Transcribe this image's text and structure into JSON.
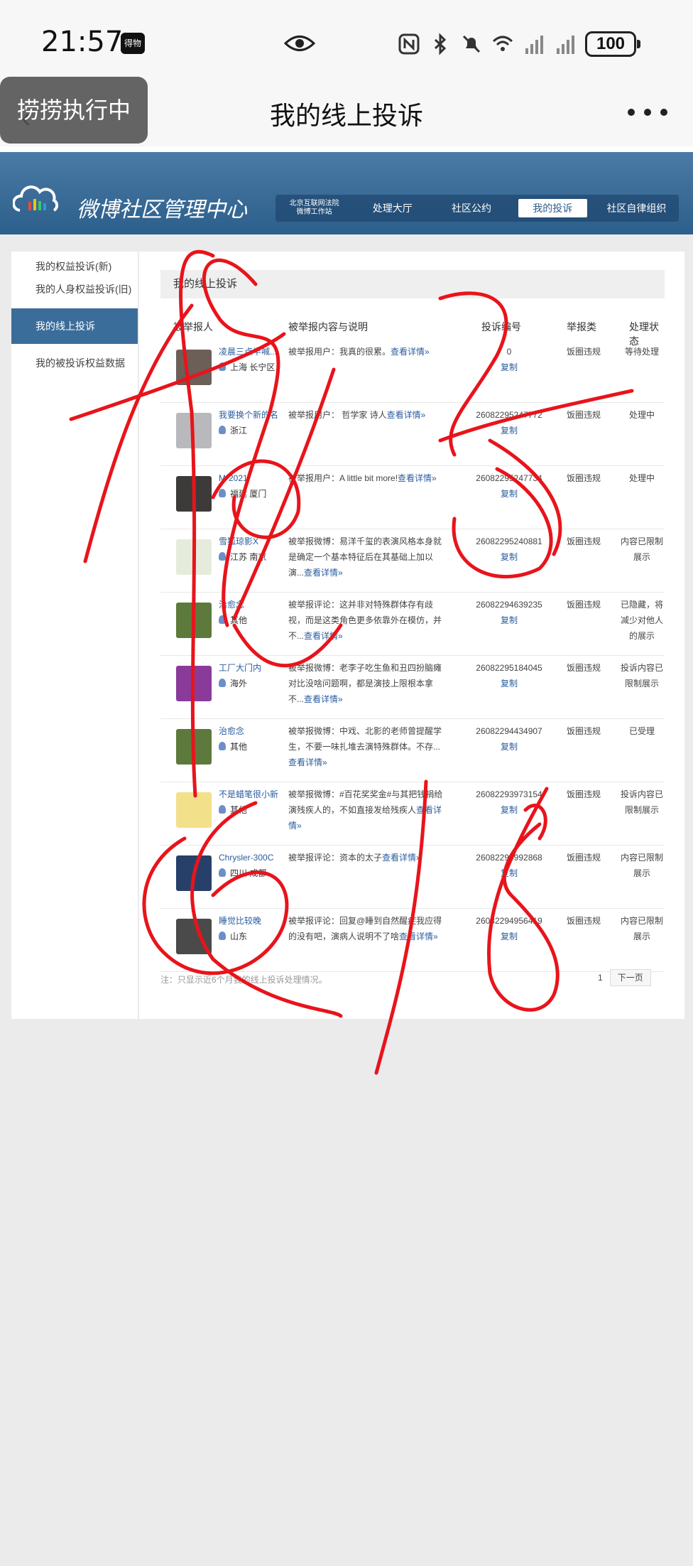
{
  "status_bar": {
    "time": "21:57",
    "badge": "得物",
    "battery": "100"
  },
  "app_header": {
    "title": "我的线上投诉",
    "toast": "捞捞执行中"
  },
  "site": {
    "logo_text": "微博社区管理中心",
    "nav": {
      "court_line1": "北京互联网法院",
      "court_line2": "微博工作站",
      "hall": "处理大厅",
      "rules": "社区公约",
      "mine": "我的投诉",
      "org": "社区自律组织"
    }
  },
  "sidebar": {
    "items": [
      {
        "label": "我的权益投诉(新)"
      },
      {
        "label": "我的人身权益投诉(旧)"
      },
      {
        "label": "我的线上投诉"
      },
      {
        "label": "我的被投诉权益数据"
      }
    ]
  },
  "main": {
    "title": "我的线上投诉",
    "columns": {
      "reporter": "被举报人",
      "content": "被举报内容与说明",
      "id": "投诉编号",
      "category": "举报类",
      "status": "处理状态"
    },
    "copy_label": "复制",
    "rows": [
      {
        "name": "凌晨三点半喊...",
        "location": "上海 长宁区",
        "content": "被举报用户：我真的很累。",
        "more": "查看详情»",
        "cid": "0",
        "category": "饭圈违规",
        "status": "等待处理",
        "avatar_color": "#6b5f58"
      },
      {
        "name": "我要换个新的名",
        "location": "浙江",
        "content": "被举报用户： 哲学家 诗人",
        "more": "查看详情»",
        "cid": "26082295247772",
        "category": "饭圈违规",
        "status": "处理中",
        "avatar_color": "#b9b9bd"
      },
      {
        "name": "M·2021",
        "location": "福建 厦门",
        "content": "被举报用户：A little bit more!",
        "more": "查看详情»",
        "cid": "26082295247734",
        "category": "饭圈违规",
        "status": "处理中",
        "avatar_color": "#3d3a3a"
      },
      {
        "name": "雪狐琼影X",
        "location": "江苏 南京",
        "content": "被举报微博：易洋千玺的表演风格本身就是确定一个基本特征后在其基础上加以演...",
        "more": "查看详情»",
        "cid": "26082295240881",
        "category": "饭圈违规",
        "status": "内容已限制展示",
        "avatar_color": "#e6ecdc"
      },
      {
        "name": "治愈念",
        "location": "其他",
        "content": "被举报评论：这并非对特殊群体存有歧视，而是这类角色更多依靠外在模仿，并不...",
        "more": "查看详情»",
        "cid": "26082294639235",
        "category": "饭圈违规",
        "status": "已隐藏，将减少对他人的展示",
        "avatar_color": "#5d7a3c"
      },
      {
        "name": "工厂大门内",
        "location": "海外",
        "content": "被举报微博：老李子吃生鱼和丑四扮脑瘫对比没啥问题啊，都是演技上限根本拿不...",
        "more": "查看详情»",
        "cid": "26082295184045",
        "category": "饭圈违规",
        "status": "投诉内容已限制展示",
        "avatar_color": "#8a3b9a"
      },
      {
        "name": "治愈念",
        "location": "其他",
        "content": "被举报微博：中戏、北影的老师曾提醒学生，不要一味扎堆去演特殊群体。不存...",
        "more": "查看详情»",
        "cid": "26082294434907",
        "category": "饭圈违规",
        "status": "已受理",
        "avatar_color": "#5d7a3c"
      },
      {
        "name": "不是蜡笔很小新",
        "location": "其他",
        "content": "被举报微博：#百花奖奖金#与其把钱捐给演残疾人的，不如直接发给残疾人",
        "more": "查看详情»",
        "cid": "26082293973154",
        "category": "饭圈违规",
        "status": "投诉内容已限制展示",
        "avatar_color": "#f2e08a"
      },
      {
        "name": "Chrysler-300C",
        "location": "四川 成都",
        "content": "被举报评论：资本的太子",
        "more": "查看详情»",
        "cid": "26082294992868",
        "category": "饭圈违规",
        "status": "内容已限制展示",
        "avatar_color": "#27406a"
      },
      {
        "name": "睡觉比较晚",
        "location": "山东",
        "content": "被举报评论：回复@睡到自然醒症我应得的没有吧，演病人说明不了啥",
        "more": "查看详情»",
        "cid": "26082294956419",
        "category": "饭圈违规",
        "status": "内容已限制展示",
        "avatar_color": "#4a4a4a"
      }
    ],
    "footnote": "注：只显示近6个月我的线上投诉处理情况。",
    "pager": {
      "page": "1",
      "next": "下一页"
    }
  },
  "handwriting": {
    "ink_color": "#e8141b"
  }
}
